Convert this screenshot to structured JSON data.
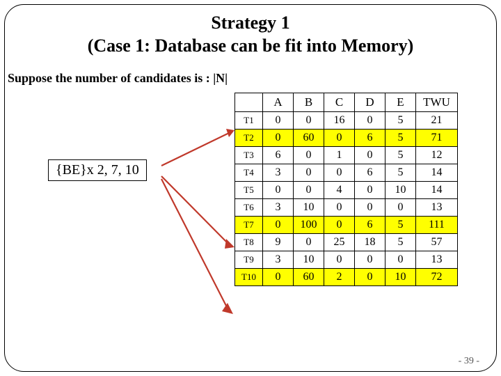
{
  "title_line1": "Strategy 1",
  "title_line2": "(Case 1: Database can be fit into Memory)",
  "suppose_text": "Suppose the number of candidates is : |N|",
  "be_label": "{BE}x 2, 7, 10",
  "table": {
    "columns": [
      "A",
      "B",
      "C",
      "D",
      "E",
      "TWU"
    ],
    "rows": [
      {
        "id": "T1",
        "vals": [
          0,
          0,
          16,
          0,
          5,
          21
        ],
        "hl": false
      },
      {
        "id": "T2",
        "vals": [
          0,
          60,
          0,
          6,
          5,
          71
        ],
        "hl": true
      },
      {
        "id": "T3",
        "vals": [
          6,
          0,
          1,
          0,
          5,
          12
        ],
        "hl": false
      },
      {
        "id": "T4",
        "vals": [
          3,
          0,
          0,
          6,
          5,
          14
        ],
        "hl": false
      },
      {
        "id": "T5",
        "vals": [
          0,
          0,
          4,
          0,
          10,
          14
        ],
        "hl": false
      },
      {
        "id": "T6",
        "vals": [
          3,
          10,
          0,
          0,
          0,
          13
        ],
        "hl": false
      },
      {
        "id": "T7",
        "vals": [
          0,
          100,
          0,
          6,
          5,
          111
        ],
        "hl": true
      },
      {
        "id": "T8",
        "vals": [
          9,
          0,
          25,
          18,
          5,
          57
        ],
        "hl": false
      },
      {
        "id": "T9",
        "vals": [
          3,
          10,
          0,
          0,
          0,
          13
        ],
        "hl": false
      },
      {
        "id": "T10",
        "vals": [
          0,
          60,
          2,
          0,
          10,
          72
        ],
        "hl": true
      }
    ]
  },
  "page_number": "- 39 -"
}
